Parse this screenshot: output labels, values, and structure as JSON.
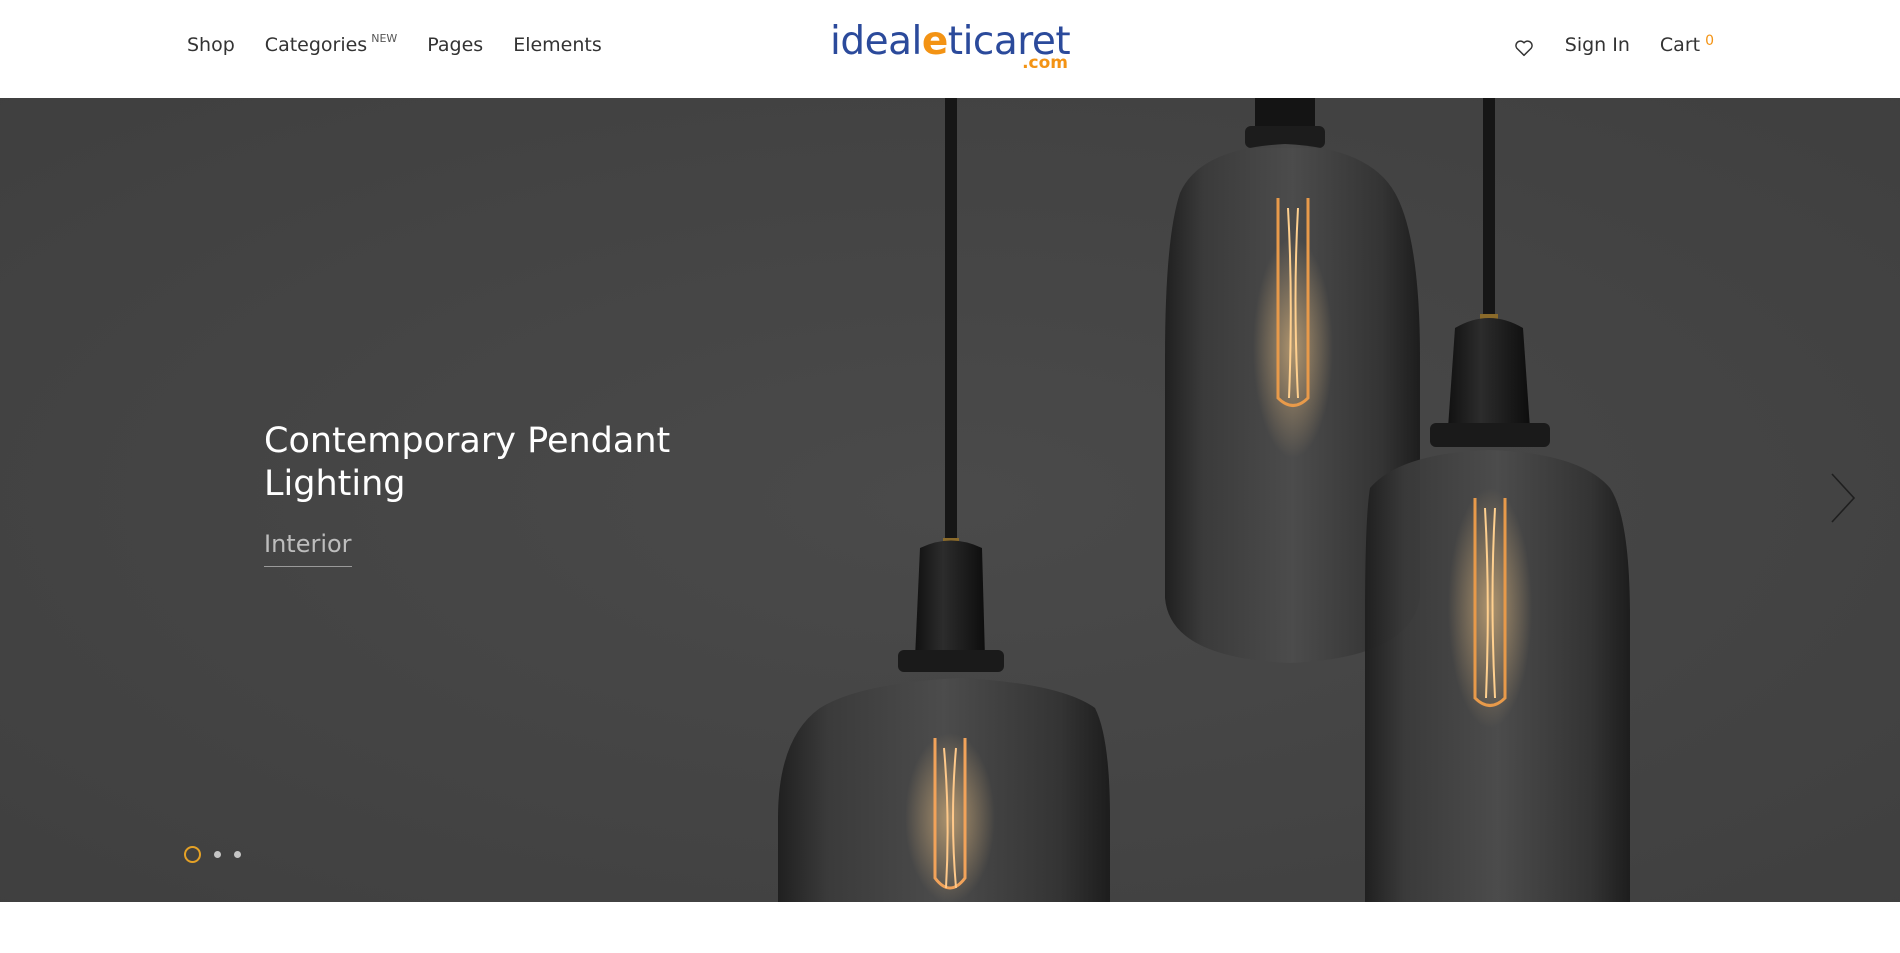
{
  "header": {
    "nav": [
      {
        "label": "Shop"
      },
      {
        "label": "Categories",
        "badge": "NEW"
      },
      {
        "label": "Pages"
      },
      {
        "label": "Elements"
      }
    ],
    "logo": {
      "text_before": "ideal",
      "text_e": "e",
      "text_after": "ticaret",
      "suffix": ".com"
    },
    "wishlist_icon": "heart-icon",
    "sign_in": "Sign In",
    "cart_label": "Cart",
    "cart_count": "0"
  },
  "hero": {
    "title": "Contemporary Pendant Lighting",
    "link": "Interior",
    "slides_total": 3,
    "active_slide": 1,
    "next_icon": "chevron-right-icon"
  },
  "colors": {
    "accent": "#f39314",
    "logo_blue": "#2b4a9b",
    "hero_bg": "#444444",
    "dot_active": "#e4a126"
  }
}
